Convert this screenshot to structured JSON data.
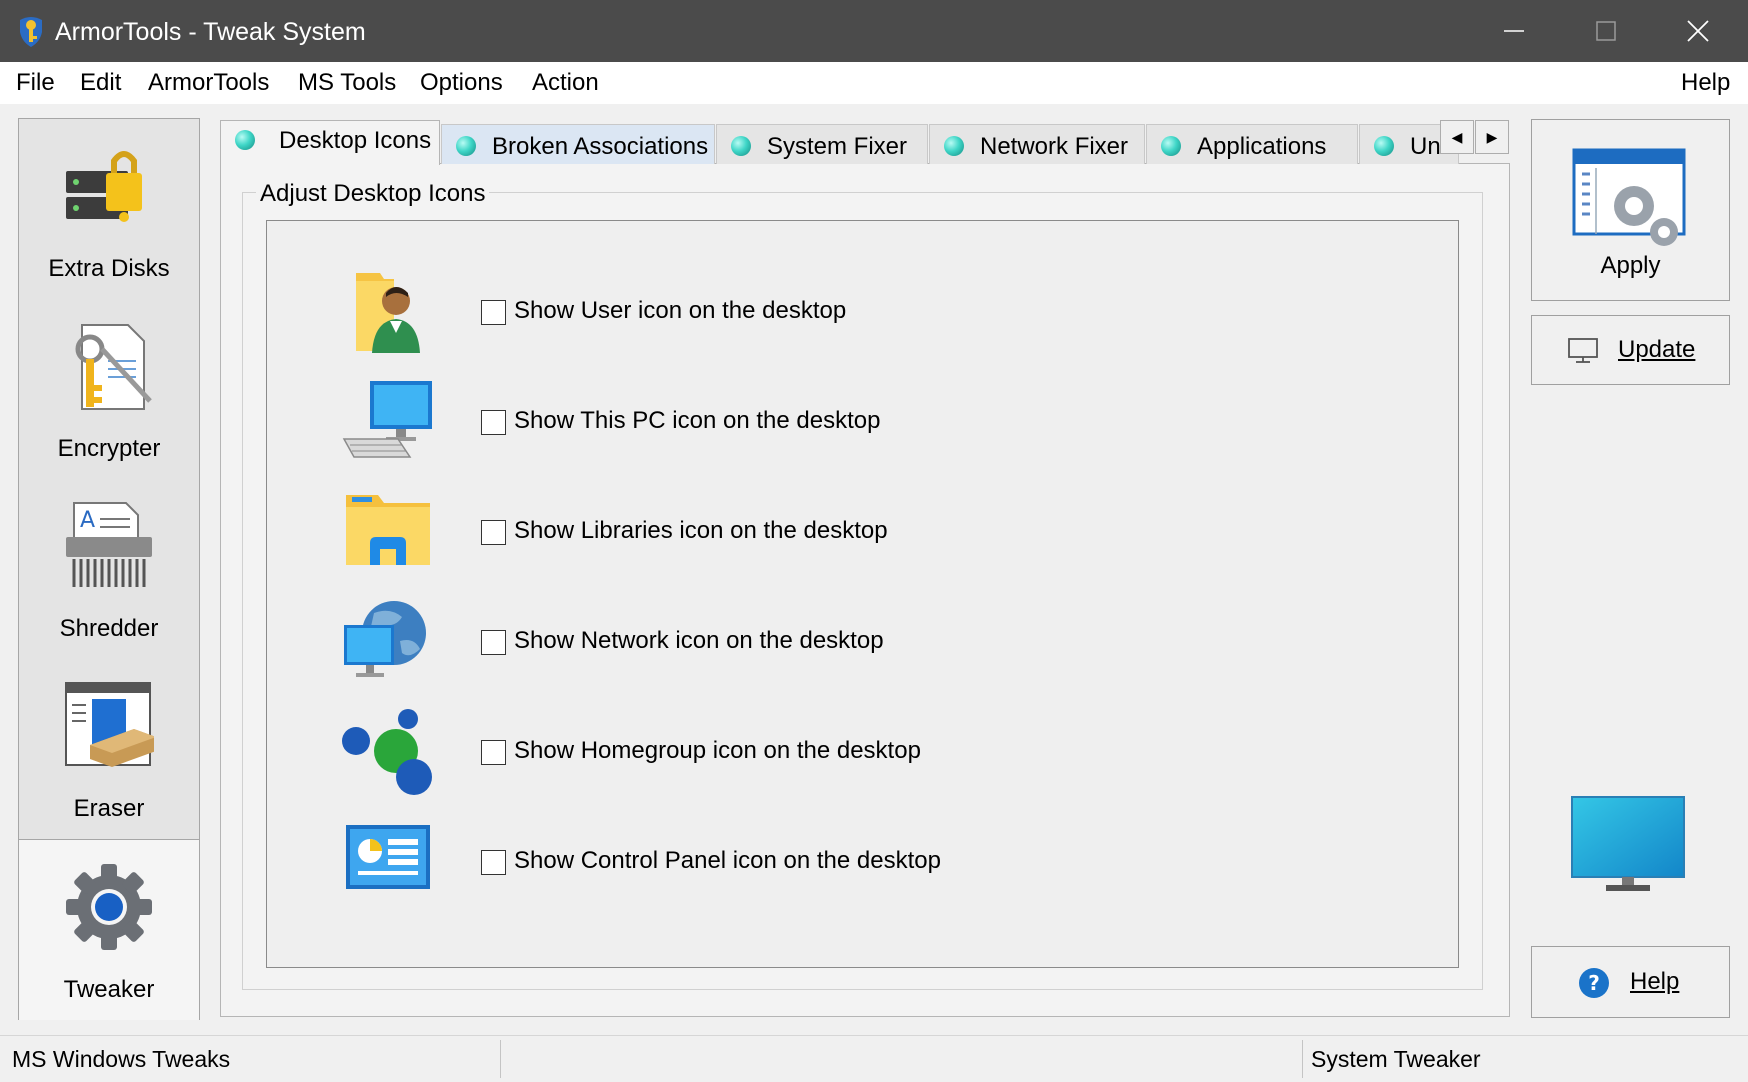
{
  "window": {
    "title": "ArmorTools - Tweak System"
  },
  "menu": {
    "items": [
      "File",
      "Edit",
      "ArmorTools",
      "MS Tools",
      "Options",
      "Action"
    ],
    "help": "Help"
  },
  "sidebar": {
    "items": [
      {
        "label": "Extra Disks",
        "icon": "disk-lock-icon"
      },
      {
        "label": "Encrypter",
        "icon": "document-key-icon"
      },
      {
        "label": "Shredder",
        "icon": "shredder-icon"
      },
      {
        "label": "Eraser",
        "icon": "eraser-icon"
      },
      {
        "label": "Tweaker",
        "icon": "gear-icon",
        "active": true
      }
    ]
  },
  "tabs": [
    {
      "label": "Desktop Icons",
      "active": true
    },
    {
      "label": "Broken Associations"
    },
    {
      "label": "System Fixer"
    },
    {
      "label": "Network Fixer"
    },
    {
      "label": "Applications"
    },
    {
      "label": "Uni"
    }
  ],
  "group": {
    "title": "Adjust Desktop Icons",
    "options": [
      {
        "label": "Show User icon on the desktop",
        "icon": "user-folder-icon",
        "checked": false
      },
      {
        "label": "Show This PC icon on the desktop",
        "icon": "this-pc-icon",
        "checked": false
      },
      {
        "label": "Show Libraries icon on the desktop",
        "icon": "libraries-icon",
        "checked": false
      },
      {
        "label": "Show Network icon on the desktop",
        "icon": "network-icon",
        "checked": false
      },
      {
        "label": "Show Homegroup icon on the desktop",
        "icon": "homegroup-icon",
        "checked": false
      },
      {
        "label": "Show Control Panel icon on the desktop",
        "icon": "control-panel-icon",
        "checked": false
      }
    ]
  },
  "actions": {
    "apply": "Apply",
    "update": "Update",
    "help": "Help"
  },
  "status": {
    "left": "MS Windows Tweaks",
    "right": "System Tweaker"
  },
  "colors": {
    "titlebar": "#4b4b4b",
    "tab_dot": "#3fd6c7",
    "help_blue": "#1a73c9"
  }
}
